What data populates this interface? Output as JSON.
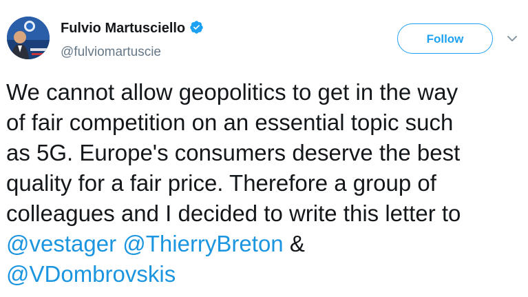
{
  "author": {
    "display_name": "Fulvio Martusciello",
    "handle": "@fulviomartuscie",
    "verified": true
  },
  "follow_button": {
    "label": "Follow"
  },
  "menu_icon": "chevron-down-icon",
  "tweet": {
    "lines": [
      "We cannot allow geopolitics to get in the way",
      "of fair competition on an essential topic such",
      "as 5G. Europe's consumers deserve the best",
      "quality for a fair price. Therefore a group of",
      "colleagues and I decided to write this letter to"
    ],
    "mention_1": "@vestager",
    "mention_2": "@ThierryBreton",
    "ampersand": "&",
    "mention_3": "@VDombrovskis"
  },
  "colors": {
    "accent": "#1da1f2",
    "mention": "#1b95e0",
    "text": "#14171a",
    "secondary_text": "#657786"
  }
}
